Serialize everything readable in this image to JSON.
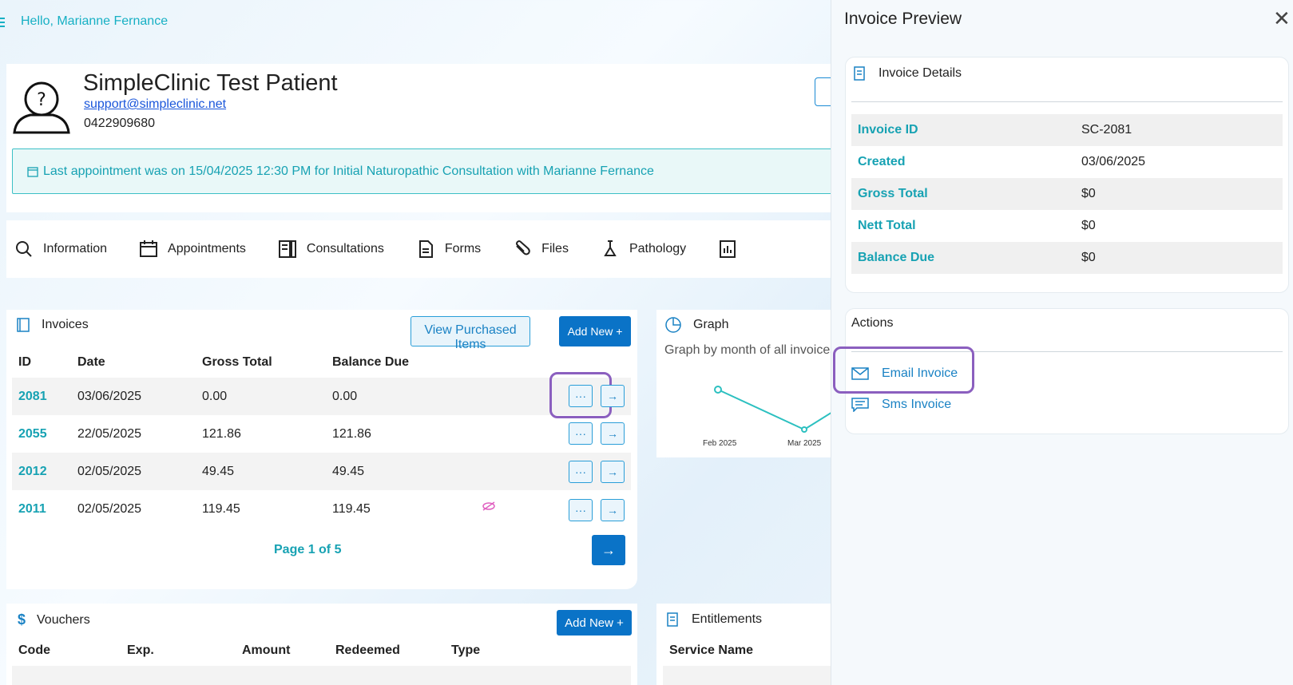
{
  "header": {
    "greeting": "Hello, Marianne Fernance"
  },
  "patient": {
    "name": "SimpleClinic Test Patient",
    "email": "support@simpleclinic.net",
    "phone": "0422909680",
    "last_appointment": "Last appointment was on 15/04/2025 12:30 PM for Initial Naturopathic Consultation with Marianne Fernance"
  },
  "tabs": [
    {
      "label": "Information",
      "icon": "search-icon"
    },
    {
      "label": "Appointments",
      "icon": "calendar-icon"
    },
    {
      "label": "Consultations",
      "icon": "notes-icon"
    },
    {
      "label": "Forms",
      "icon": "form-icon"
    },
    {
      "label": "Files",
      "icon": "paperclip-icon"
    },
    {
      "label": "Pathology",
      "icon": "pathology-icon"
    }
  ],
  "invoices": {
    "title": "Invoices",
    "view_purchased_label": "View Purchased Items",
    "add_new_label": "Add New +",
    "columns": [
      "ID",
      "Date",
      "Gross Total",
      "Balance Due"
    ],
    "rows": [
      {
        "id": "2081",
        "date": "03/06/2025",
        "gross": "0.00",
        "balance": "0.00",
        "hidden": false
      },
      {
        "id": "2055",
        "date": "22/05/2025",
        "gross": "121.86",
        "balance": "121.86",
        "hidden": false
      },
      {
        "id": "2012",
        "date": "02/05/2025",
        "gross": "49.45",
        "balance": "49.45",
        "hidden": false
      },
      {
        "id": "2011",
        "date": "02/05/2025",
        "gross": "119.45",
        "balance": "119.45",
        "hidden": true
      }
    ],
    "pagination": "Page 1 of 5",
    "more_label": "···",
    "open_label": "→"
  },
  "graph": {
    "title": "Graph",
    "subtitle": "Graph by month of all invoices",
    "x_labels": [
      "Feb 2025",
      "Mar 2025"
    ]
  },
  "vouchers": {
    "title": "Vouchers",
    "add_new_label": "Add New +",
    "columns": [
      "Code",
      "Exp.",
      "Amount",
      "Redeemed",
      "Type"
    ]
  },
  "entitlements": {
    "title": "Entitlements",
    "columns": [
      "Service Name"
    ]
  },
  "preview": {
    "title": "Invoice Preview",
    "details_title": "Invoice Details",
    "details": [
      {
        "label": "Invoice ID",
        "value": "SC-2081"
      },
      {
        "label": "Created",
        "value": "03/06/2025"
      },
      {
        "label": "Gross Total",
        "value": "$0"
      },
      {
        "label": "Nett Total",
        "value": "$0"
      },
      {
        "label": "Balance Due",
        "value": "$0"
      }
    ],
    "actions_title": "Actions",
    "email_label": "Email Invoice",
    "sms_label": "Sms Invoice"
  },
  "colors": {
    "accent": "#17a2b3",
    "primary": "#0a73c7",
    "highlight": "#8b5fbf"
  }
}
